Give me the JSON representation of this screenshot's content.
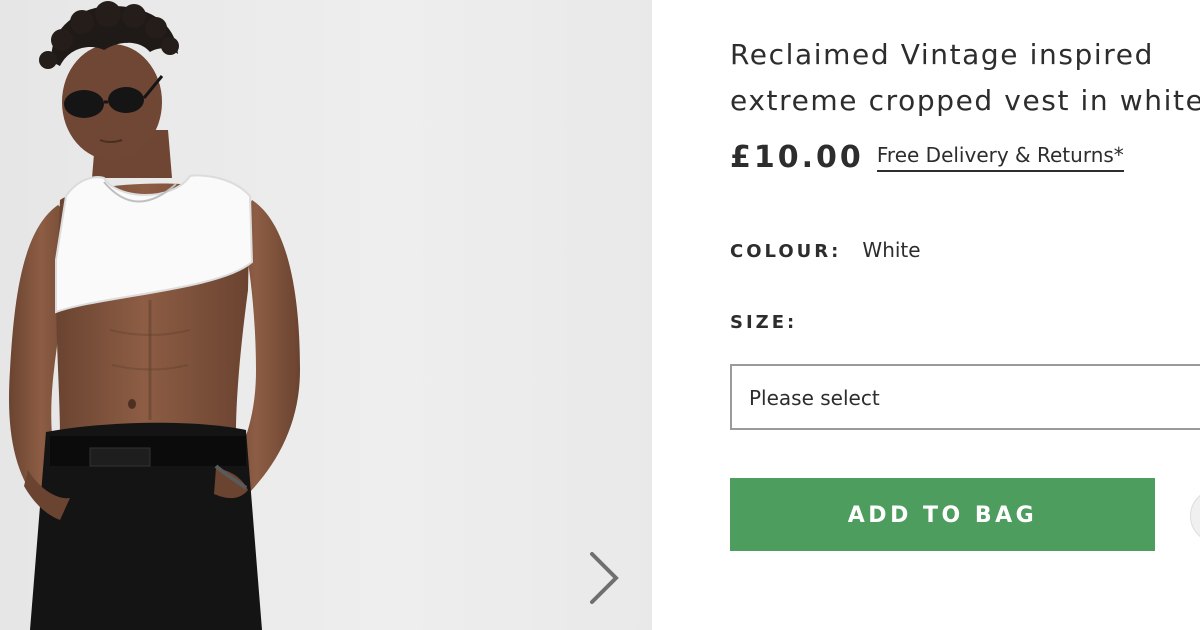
{
  "product": {
    "title_line1": "Reclaimed Vintage inspired",
    "title_line2": "extreme cropped vest in white",
    "price": "£10.00",
    "delivery_link": "Free Delivery & Returns*",
    "colour_label": "COLOUR:",
    "colour_value": "White",
    "size_label": "SIZE:",
    "size_placeholder": "Please select",
    "add_to_bag_label": "ADD TO BAG"
  },
  "gallery": {
    "next_icon": "chevron-right-icon"
  },
  "colors": {
    "add_to_bag": "#4d9d5f",
    "text": "#2d2d2d",
    "image_background": "#eeeeee"
  }
}
